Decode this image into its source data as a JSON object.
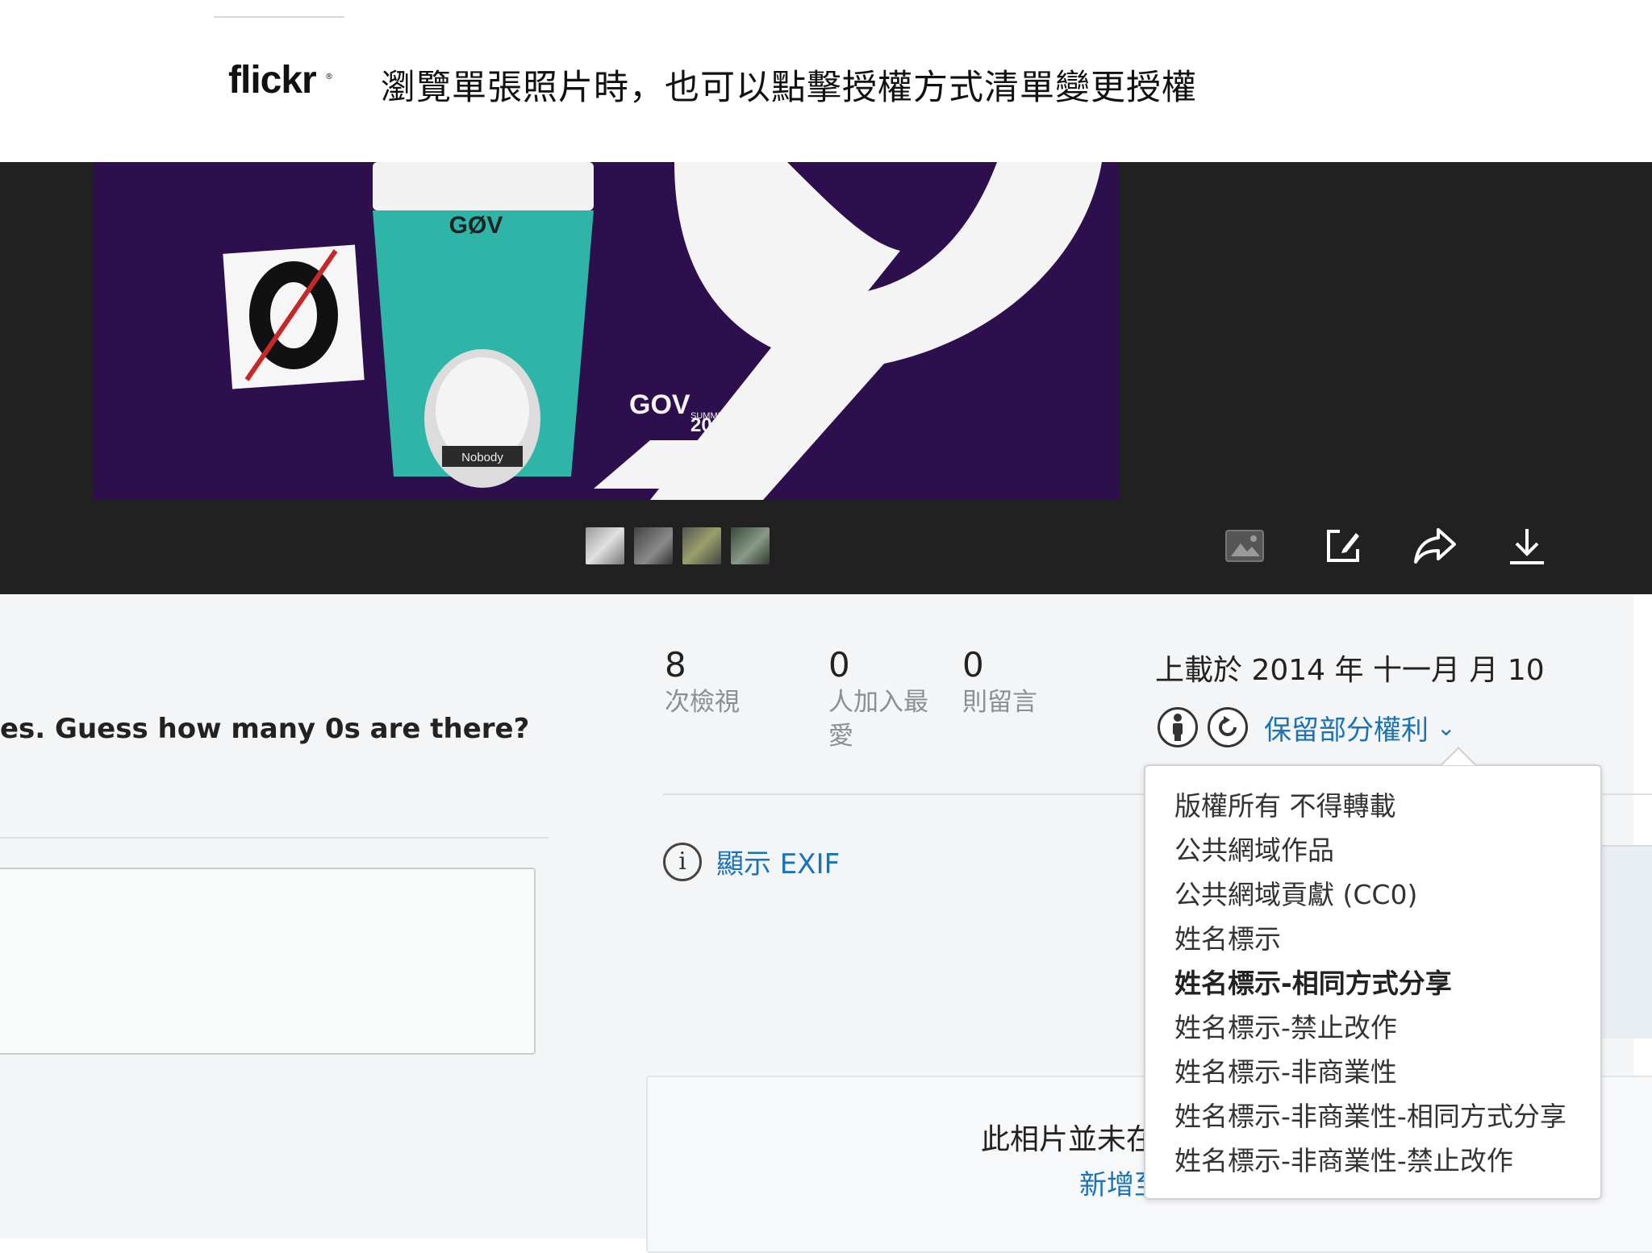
{
  "header": {
    "logo_text": "flickr",
    "logo_mark": "®",
    "caption": "瀏覽單張照片時，也可以點擊授權方式清單變更授權"
  },
  "viewer": {
    "thumbnail_count": 4,
    "toolbar_icons": [
      "image-icon",
      "edit-icon",
      "share-icon",
      "download-icon"
    ]
  },
  "photo": {
    "description": "es. Guess how many 0s are there?",
    "comment_placeholder": ""
  },
  "stats": [
    {
      "value": "8",
      "label": "次檢視"
    },
    {
      "value": "0",
      "label": "人加入最愛"
    },
    {
      "value": "0",
      "label": "則留言"
    }
  ],
  "upload": {
    "date_text": "上載於 2014 年 十一月 月 10"
  },
  "license": {
    "current": "保留部分權利",
    "icons": [
      "attribution-icon",
      "sharealike-icon"
    ],
    "options": [
      "版權所有 不得轉載",
      "公共網域作品",
      "公共網域貢獻 (CC0)",
      "姓名標示",
      "姓名標示-相同方式分享",
      "姓名標示-禁止改作",
      "姓名標示-非商業性",
      "姓名標示-非商業性-相同方式分享",
      "姓名標示-非商業性-禁止改作"
    ],
    "selected_index": 4
  },
  "exif": {
    "link": "顯示 EXIF"
  },
  "groups_card": {
    "title": "此相片並未在",
    "link": "新增至"
  },
  "colors": {
    "link": "#1a73b8",
    "viewer_bg": "#212121",
    "info_bg": "#f3f5f6"
  }
}
